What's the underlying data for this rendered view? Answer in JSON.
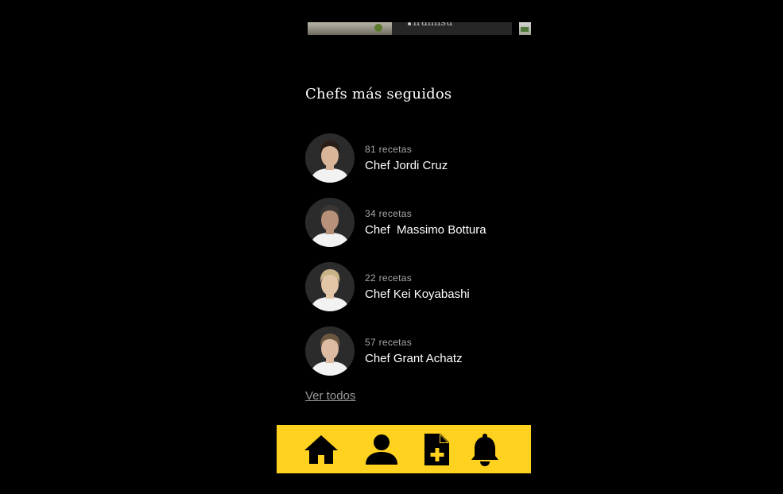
{
  "carousel": {
    "visible_card_title": "Tiramisu"
  },
  "section": {
    "title": "Chefs más seguidos"
  },
  "chefs": [
    {
      "count": "81 recetas",
      "name": "Chef Jordi Cruz",
      "hair": "#2a1f18",
      "skin": "#d9b59a"
    },
    {
      "count": "34 recetas",
      "name": "Chef  Massimo Bottura",
      "hair": "#3a3633",
      "skin": "#b8917a"
    },
    {
      "count": "22 recetas",
      "name": "Chef Kei Koyabashi",
      "hair": "#c9b48a",
      "skin": "#e3c6a8"
    },
    {
      "count": "57 recetas",
      "name": "Chef Grant Achatz",
      "hair": "#6b5640",
      "skin": "#dcbba2"
    }
  ],
  "see_all": {
    "label": "Ver todos"
  },
  "tabbar": {
    "background": "#ffd21f",
    "icons": [
      "home-icon",
      "profile-icon",
      "add-recipe-icon",
      "notifications-icon"
    ]
  }
}
